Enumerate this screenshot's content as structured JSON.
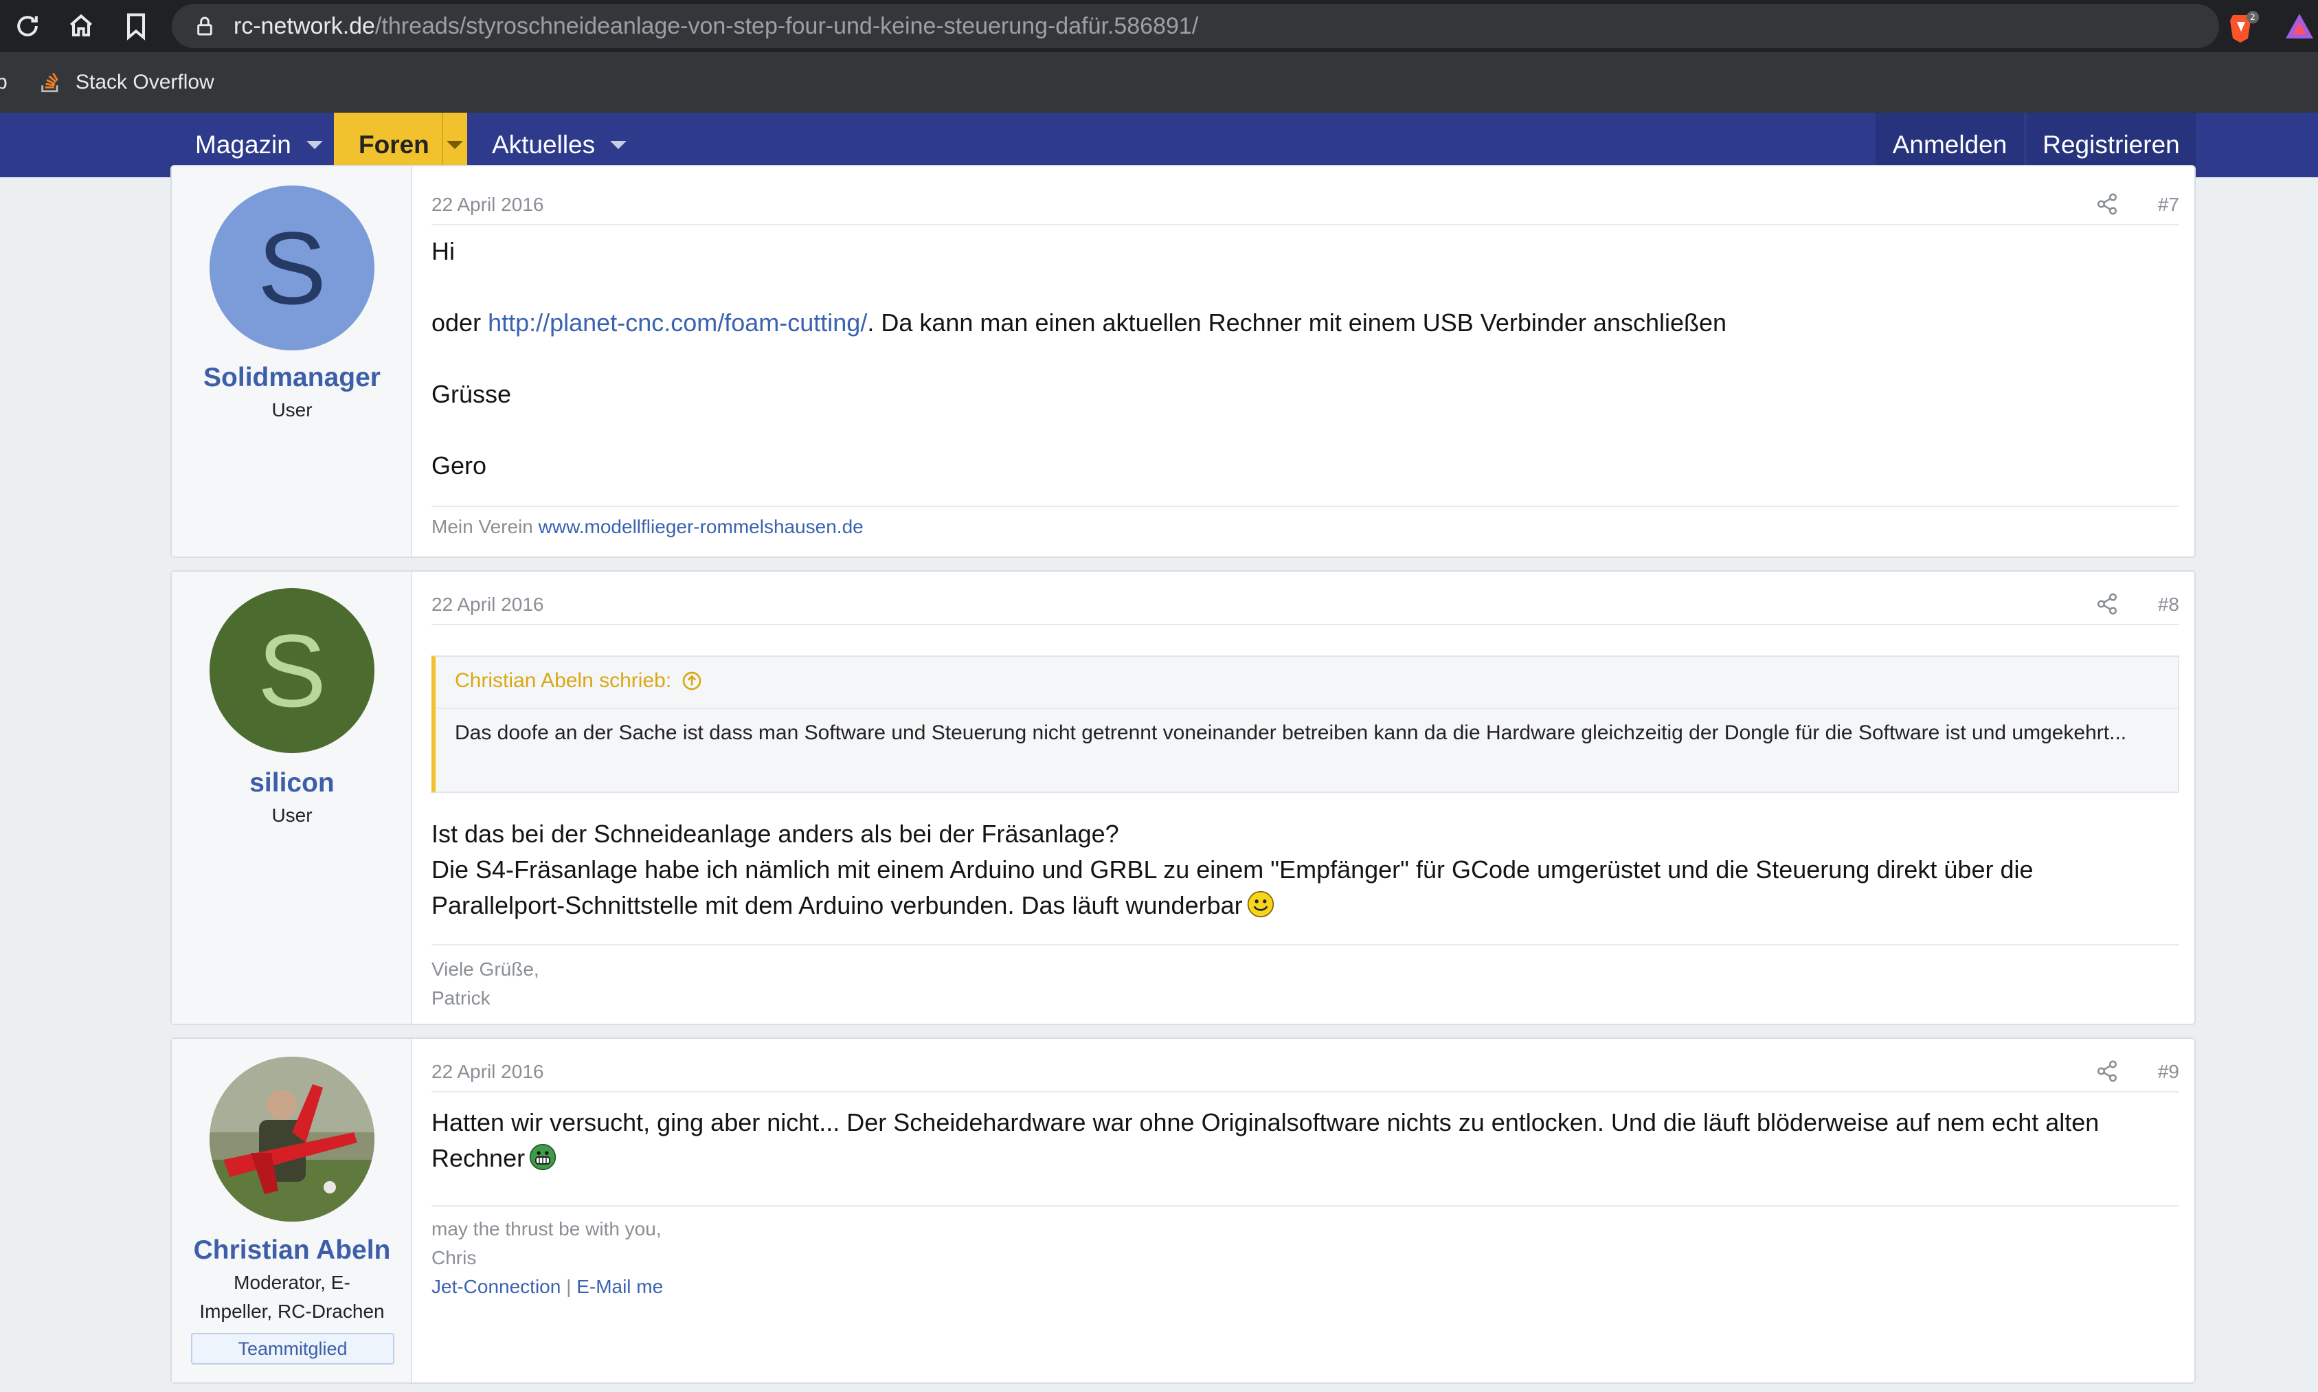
{
  "browser": {
    "url_host": "rc-network.de",
    "url_path": "/threads/styroschneideanlage-von-step-four-und-keine-steuerung-dafür.586891/",
    "extension_badge": "2",
    "bookmarks": [
      {
        "label": "b"
      },
      {
        "label": "Stack Overflow"
      }
    ]
  },
  "nav": {
    "tabs": [
      {
        "label": "Magazin",
        "active": false
      },
      {
        "label": "Foren",
        "active": true
      },
      {
        "label": "Aktuelles",
        "active": false
      }
    ],
    "login_label": "Anmelden",
    "register_label": "Registrieren",
    "colors": {
      "bar": "#2e3a8c",
      "active_tab": "#f2c12e"
    }
  },
  "posts": [
    {
      "number": "#7",
      "date": "22 April 2016",
      "user": {
        "name": "Solidmanager",
        "initial": "S",
        "title": "User"
      },
      "body": {
        "line1": "Hi",
        "line2_prefix": "oder ",
        "line2_link": "http://planet-cnc.com/foam-cutting/",
        "line2_suffix": ". Da kann man einen aktuellen Rechner mit einem USB Verbinder anschließen",
        "line3": "Grüsse",
        "line4": "Gero"
      },
      "signature": {
        "prefix": "Mein Verein ",
        "link": "www.modellflieger-rommelshausen.de"
      }
    },
    {
      "number": "#8",
      "date": "22 April 2016",
      "user": {
        "name": "silicon",
        "initial": "S",
        "title": "User"
      },
      "quote": {
        "author": "Christian Abeln schrieb:",
        "text": "Das doofe an der Sache ist dass man Software und Steuerung nicht getrennt voneinander betreiben kann da die Hardware gleichzeitig der Dongle für die Software ist und umgekehrt..."
      },
      "body": {
        "line1": "Ist das bei der Schneideanlage anders als bei der Fräsanlage?",
        "line2": "Die S4-Fräsanlage habe ich nämlich mit einem Arduino und GRBL zu einem \"Empfänger\" für GCode umgerüstet und die Steuerung direkt über die",
        "line3": "Parallelport-Schnittstelle mit dem Arduino verbunden. Das läuft wunderbar"
      },
      "signature": {
        "line1": "Viele Grüße,",
        "line2": "Patrick"
      }
    },
    {
      "number": "#9",
      "date": "22 April 2016",
      "user": {
        "name": "Christian Abeln",
        "title_line1": "Moderator, E-",
        "title_line2": "Impeller, RC-Drachen",
        "badge": "Teammitglied"
      },
      "body": {
        "line1": "Hatten wir versucht, ging aber nicht... Der Scheidehardware war ohne Originalsoftware nichts zu entlocken. Und die läuft blöderweise auf nem echt alten",
        "line2": "Rechner"
      },
      "signature": {
        "line1": "may the thrust be with you,",
        "line2": "Chris",
        "link1": "Jet-Connection",
        "separator": " | ",
        "link2": "E-Mail me"
      }
    }
  ]
}
